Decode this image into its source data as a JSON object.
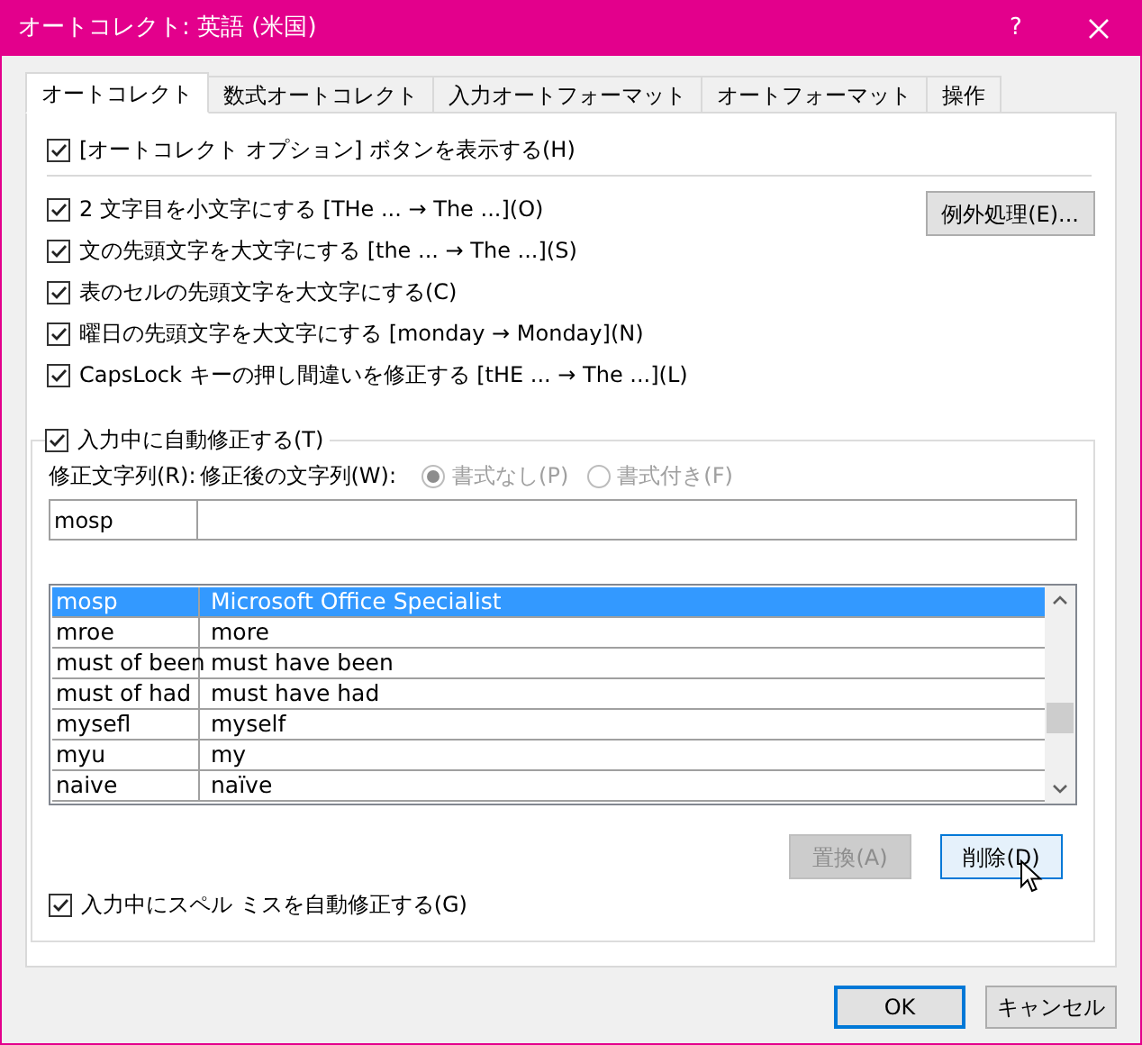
{
  "window": {
    "title": "オートコレクト: 英語 (米国)",
    "help": "?"
  },
  "tabs": [
    {
      "label": "オートコレクト",
      "selected": true
    },
    {
      "label": "数式オートコレクト",
      "selected": false
    },
    {
      "label": "入力オートフォーマット",
      "selected": false
    },
    {
      "label": "オートフォーマット",
      "selected": false
    },
    {
      "label": "操作",
      "selected": false
    }
  ],
  "show_options_button": {
    "label": "[オートコレクト オプション] ボタンを表示する(H)",
    "checked": true
  },
  "rules": [
    {
      "label": "2 文字目を小文字にする [THe ... → The ...](O)",
      "checked": true
    },
    {
      "label": "文の先頭文字を大文字にする [the ... → The ...](S)",
      "checked": true
    },
    {
      "label": "表のセルの先頭文字を大文字にする(C)",
      "checked": true
    },
    {
      "label": "曜日の先頭文字を大文字にする [monday →  Monday](N)",
      "checked": true
    },
    {
      "label": "CapsLock キーの押し間違いを修正する [tHE ... → The ...](L)",
      "checked": true
    }
  ],
  "exceptions_button": "例外処理(E)...",
  "replace_group": {
    "label": "入力中に自動修正する(T)",
    "checked": true,
    "replace_label": "修正文字列(R):",
    "with_label": "修正後の文字列(W):",
    "format_options": [
      {
        "label": "書式なし(P)",
        "selected": true
      },
      {
        "label": "書式付き(F)",
        "selected": false
      }
    ],
    "format_disabled": true,
    "replace_value": "mosp",
    "rows": [
      {
        "replace": "mosp",
        "with": "Microsoft Office Specialist",
        "selected": true
      },
      {
        "replace": "mroe",
        "with": "more",
        "selected": false
      },
      {
        "replace": "must of been",
        "with": "must have been",
        "selected": false
      },
      {
        "replace": "must of had",
        "with": "must have had",
        "selected": false
      },
      {
        "replace": "mysefl",
        "with": "myself",
        "selected": false
      },
      {
        "replace": "myu",
        "with": "my",
        "selected": false
      },
      {
        "replace": "naive",
        "with": "naïve",
        "selected": false
      }
    ],
    "buttons": [
      {
        "label": "置換(A)",
        "disabled": true,
        "hovered": false
      },
      {
        "label": "削除(D)",
        "disabled": false,
        "hovered": true
      }
    ],
    "spell_check": {
      "label": "入力中にスペル ミスを自動修正する(G)",
      "checked": true
    }
  },
  "dialog_buttons": [
    {
      "label": "OK",
      "default": true
    },
    {
      "label": "キャンセル",
      "default": false
    }
  ]
}
